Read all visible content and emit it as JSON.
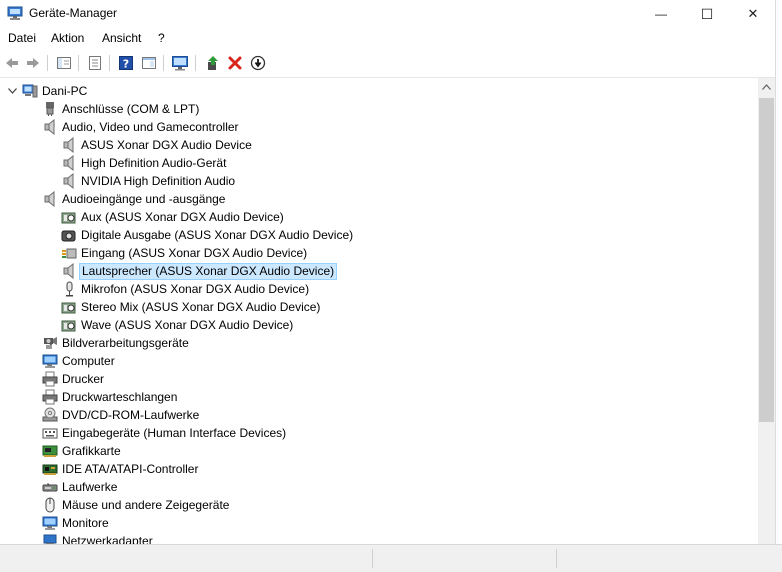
{
  "window": {
    "title": "Geräte-Manager",
    "minimize_glyph": "—",
    "maximize_glyph": "☐",
    "close_glyph": "✕"
  },
  "menu": [
    "Datei",
    "Aktion",
    "Ansicht",
    "?"
  ],
  "toolbar": {
    "icons": [
      "back-arrow-icon",
      "forward-arrow-icon",
      "show-hide-console-tree-icon",
      "properties-icon",
      "help-icon",
      "action-pane-icon",
      "scan-hardware-icon",
      "update-driver-icon",
      "uninstall-device-icon",
      "disable-device-icon"
    ]
  },
  "colors": {
    "selection_bg": "#cce8ff",
    "selection_border": "#99d1ff",
    "uninstall_red": "#d9251c",
    "help_blue": "#1f4fa8"
  },
  "tree": [
    {
      "label": "Dani-PC",
      "level": 0,
      "expander": "open",
      "icon": "computer-icon"
    },
    {
      "label": "Anschlüsse (COM & LPT)",
      "level": 1,
      "expander": "closed",
      "icon": "port-icon"
    },
    {
      "label": "Audio, Video und Gamecontroller",
      "level": 1,
      "expander": "open",
      "icon": "speaker-icon"
    },
    {
      "label": "ASUS Xonar DGX Audio Device",
      "level": 2,
      "expander": "none",
      "icon": "speaker-icon"
    },
    {
      "label": "High Definition Audio-Gerät",
      "level": 2,
      "expander": "none",
      "icon": "speaker-icon"
    },
    {
      "label": "NVIDIA High Definition Audio",
      "level": 2,
      "expander": "none",
      "icon": "speaker-icon"
    },
    {
      "label": "Audioeingänge und -ausgänge",
      "level": 1,
      "expander": "open",
      "icon": "speaker-icon"
    },
    {
      "label": "Aux (ASUS Xonar DGX Audio Device)",
      "level": 2,
      "expander": "none",
      "icon": "audio-jack-icon"
    },
    {
      "label": "Digitale Ausgabe (ASUS Xonar DGX Audio Device)",
      "level": 2,
      "expander": "none",
      "icon": "digital-output-icon"
    },
    {
      "label": "Eingang (ASUS Xonar DGX Audio Device)",
      "level": 2,
      "expander": "none",
      "icon": "line-in-icon"
    },
    {
      "label": "Lautsprecher (ASUS Xonar DGX Audio Device)",
      "level": 2,
      "expander": "none",
      "icon": "speaker-icon",
      "selected": true
    },
    {
      "label": "Mikrofon (ASUS Xonar DGX Audio Device)",
      "level": 2,
      "expander": "none",
      "icon": "microphone-icon"
    },
    {
      "label": "Stereo Mix (ASUS Xonar DGX Audio Device)",
      "level": 2,
      "expander": "none",
      "icon": "audio-jack-icon"
    },
    {
      "label": "Wave (ASUS Xonar DGX Audio Device)",
      "level": 2,
      "expander": "none",
      "icon": "audio-jack-icon"
    },
    {
      "label": "Bildverarbeitungsgeräte",
      "level": 1,
      "expander": "closed",
      "icon": "camera-icon"
    },
    {
      "label": "Computer",
      "level": 1,
      "expander": "closed",
      "icon": "monitor-icon"
    },
    {
      "label": "Drucker",
      "level": 1,
      "expander": "closed",
      "icon": "printer-icon"
    },
    {
      "label": "Druckwarteschlangen",
      "level": 1,
      "expander": "closed",
      "icon": "printer-icon"
    },
    {
      "label": "DVD/CD-ROM-Laufwerke",
      "level": 1,
      "expander": "closed",
      "icon": "disc-icon"
    },
    {
      "label": "Eingabegeräte (Human Interface Devices)",
      "level": 1,
      "expander": "closed",
      "icon": "keyboard-icon"
    },
    {
      "label": "Grafikkarte",
      "level": 1,
      "expander": "closed",
      "icon": "display-adapter-icon"
    },
    {
      "label": "IDE ATA/ATAPI-Controller",
      "level": 1,
      "expander": "closed",
      "icon": "controller-icon"
    },
    {
      "label": "Laufwerke",
      "level": 1,
      "expander": "closed",
      "icon": "drive-icon"
    },
    {
      "label": "Mäuse und andere Zeigegeräte",
      "level": 1,
      "expander": "closed",
      "icon": "mouse-icon"
    },
    {
      "label": "Monitore",
      "level": 1,
      "expander": "closed",
      "icon": "monitor-icon"
    },
    {
      "label": "Netzwerkadapter",
      "level": 1,
      "expander": "closed",
      "icon": "network-icon"
    }
  ]
}
